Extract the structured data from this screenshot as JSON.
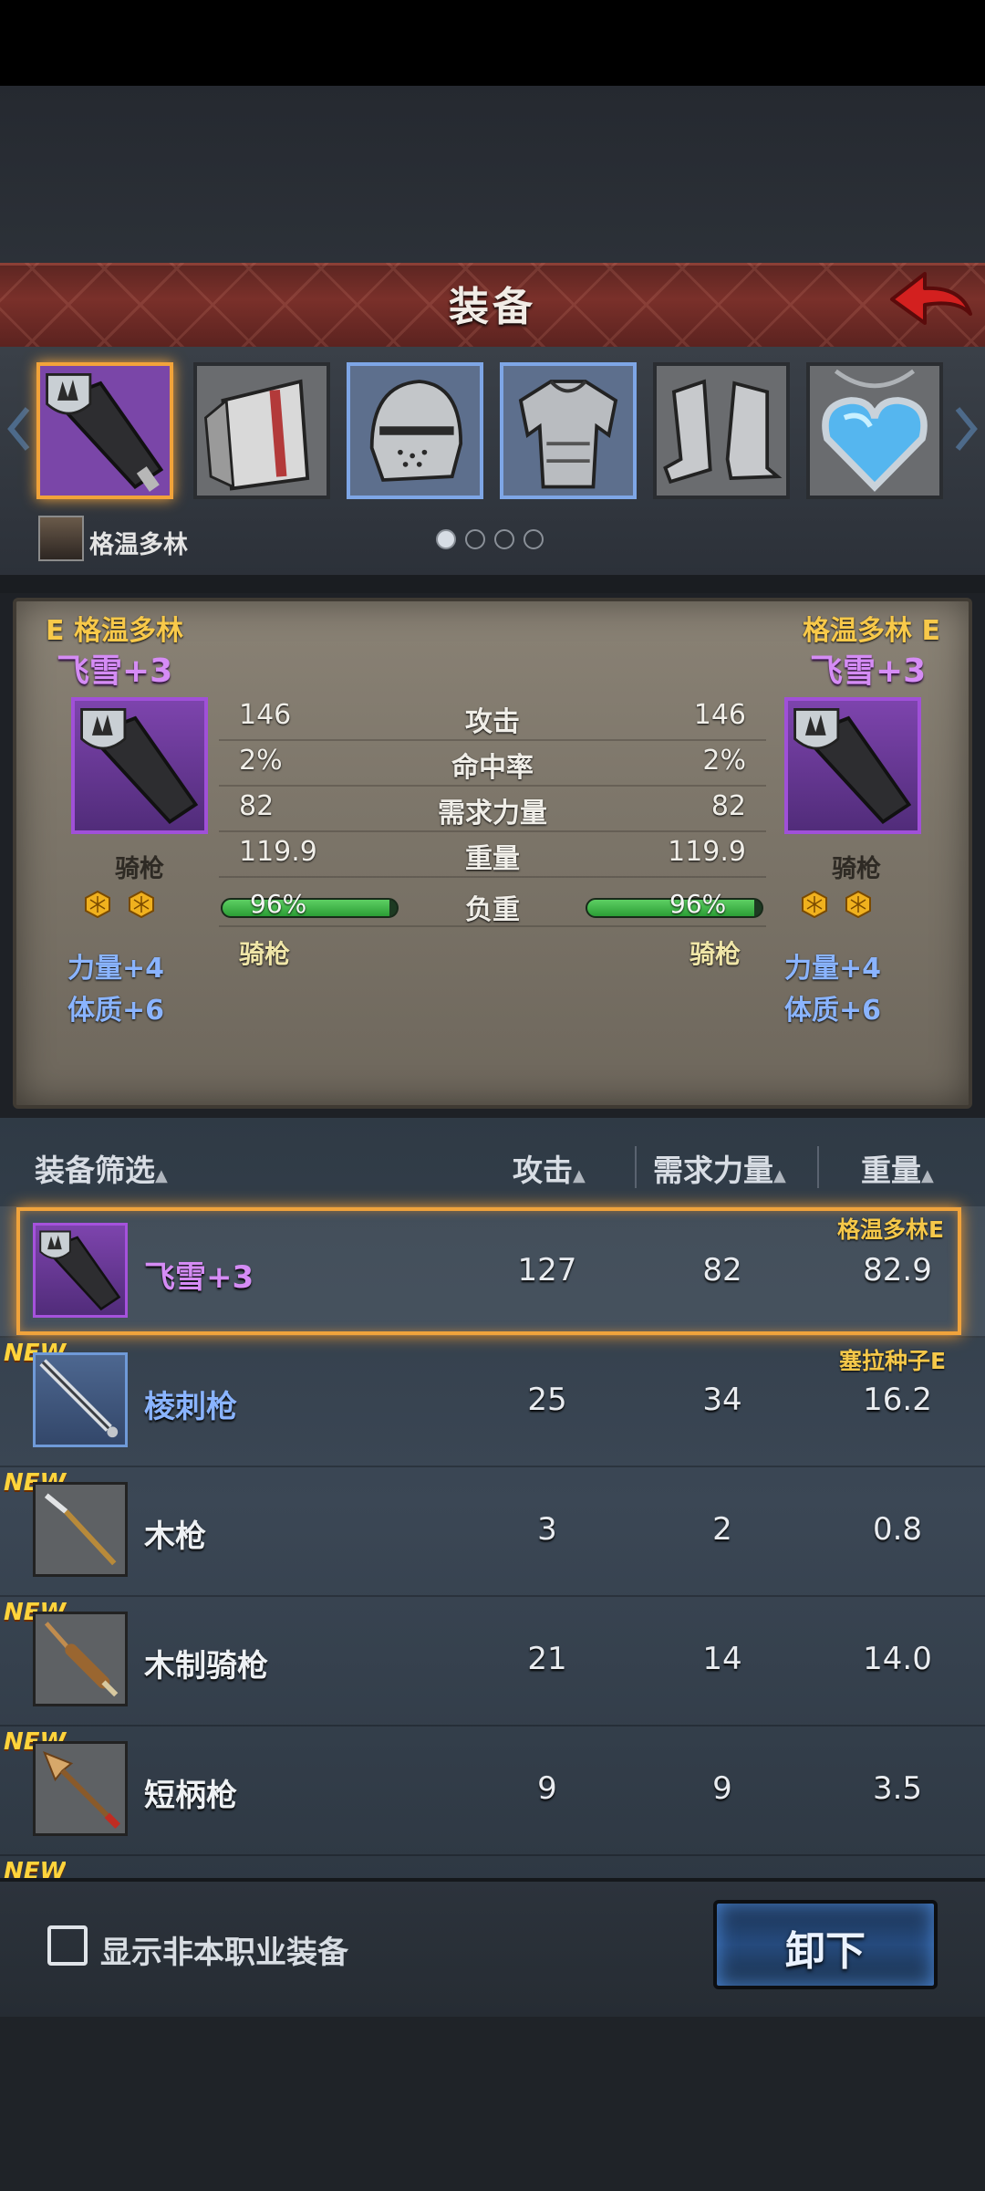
{
  "header": {
    "title": "装备"
  },
  "slots": [
    {
      "name": "lance",
      "selected": true
    },
    {
      "name": "shield"
    },
    {
      "name": "helmet",
      "rarity": "blue"
    },
    {
      "name": "armor",
      "rarity": "blue"
    },
    {
      "name": "boots"
    },
    {
      "name": "amulet"
    }
  ],
  "character": {
    "name": "格温多林"
  },
  "pagination": {
    "pages": 4,
    "current": 1
  },
  "compare": {
    "left": {
      "grade": "E",
      "owner": "格温多林",
      "item_name": "飞雪+3",
      "type": "骑枪",
      "bonuses": [
        "力量+4",
        "体质+6"
      ]
    },
    "right": {
      "grade": "E",
      "owner": "格温多林",
      "item_name": "飞雪+3",
      "type": "骑枪",
      "bonuses": [
        "力量+4",
        "体质+6"
      ]
    },
    "stats": [
      {
        "label": "攻击",
        "left": "146",
        "right": "146"
      },
      {
        "label": "命中率",
        "left": "2%",
        "right": "2%"
      },
      {
        "label": "需求力量",
        "left": "82",
        "right": "82"
      },
      {
        "label": "重量",
        "left": "119.9",
        "right": "119.9"
      }
    ],
    "load": {
      "label": "负重",
      "left": "96%",
      "right": "96%",
      "left_fraction": 0.96,
      "right_fraction": 0.96
    },
    "type_row": {
      "left": "骑枪",
      "right": "骑枪"
    }
  },
  "list": {
    "columns": {
      "filter": "装备筛选",
      "attack": "攻击",
      "strength": "需求力量",
      "weight": "重量"
    },
    "new_label": "NEW",
    "rows": [
      {
        "name": "飞雪+3",
        "attack": "127",
        "strength": "82",
        "weight": "82.9",
        "owner": "格温多林E",
        "rarity": "purple",
        "is_new": false,
        "selected": true
      },
      {
        "name": "棱刺枪",
        "attack": "25",
        "strength": "34",
        "weight": "16.2",
        "owner": "塞拉种子E",
        "rarity": "blue",
        "is_new": true,
        "selected": false
      },
      {
        "name": "木枪",
        "attack": "3",
        "strength": "2",
        "weight": "0.8",
        "owner": "",
        "rarity": "common",
        "is_new": true,
        "selected": false
      },
      {
        "name": "木制骑枪",
        "attack": "21",
        "strength": "14",
        "weight": "14.0",
        "owner": "",
        "rarity": "common",
        "is_new": true,
        "selected": false
      },
      {
        "name": "短柄枪",
        "attack": "9",
        "strength": "9",
        "weight": "3.5",
        "owner": "",
        "rarity": "common",
        "is_new": true,
        "selected": false
      }
    ]
  },
  "footer": {
    "checkbox_label": "显示非本职业装备",
    "unequip_label": "卸下"
  },
  "colors": {
    "header_red": "#7a302a",
    "highlight_orange": "#f0a33c",
    "purple_rarity": "#a050d8",
    "blue_rarity": "#7ea6e6",
    "owner_gold": "#f5c84a",
    "bonus_blue": "#8ab4ff"
  }
}
